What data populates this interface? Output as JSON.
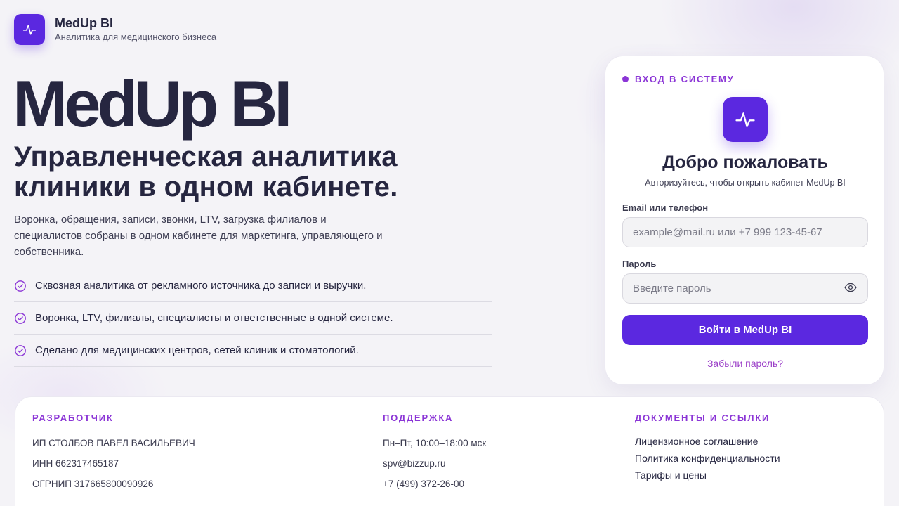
{
  "brand": {
    "name": "MedUp BI",
    "tagline": "Аналитика для медицинского бизнеса"
  },
  "hero": {
    "title": "MedUp BI",
    "subtitle": "Управленческая аналитика клиники в одном кабинете.",
    "description": "Воронка, обращения, записи, звонки, LTV, загрузка филиалов и специалистов собраны в одном кабинете для маркетинга, управляющего и собственника.",
    "features": [
      "Сквозная аналитика от рекламного источника до записи и выручки.",
      "Воронка, LTV, филиалы, специалисты и ответственные в одной системе.",
      "Сделано для медицинских центров, сетей клиник и стоматологий."
    ]
  },
  "login": {
    "eyebrow": "ВХОД В СИСТЕМУ",
    "title": "Добро пожаловать",
    "subtitle": "Авторизуйтесь, чтобы открыть кабинет MedUp BI",
    "email_label": "Email или телефон",
    "email_placeholder": "example@mail.ru или +7 999 123-45-67",
    "password_label": "Пароль",
    "password_placeholder": "Введите пароль",
    "submit_label": "Войти в MedUp BI",
    "forgot_label": "Забыли пароль?"
  },
  "footer": {
    "developer": {
      "heading": "РАЗРАБОТЧИК",
      "lines": [
        "ИП СТОЛБОВ ПАВЕЛ ВАСИЛЬЕВИЧ",
        "ИНН 662317465187",
        "ОГРНИП 317665800090926"
      ]
    },
    "support": {
      "heading": "ПОДДЕРЖКА",
      "lines": [
        "Пн–Пт, 10:00–18:00 мск",
        "spv@bizzup.ru",
        "+7 (499) 372-26-00"
      ]
    },
    "docs": {
      "heading": "ДОКУМЕНТЫ И ССЫЛКИ",
      "links": [
        "Лицензионное соглашение",
        "Политика конфиденциальности",
        "Тарифы и цены"
      ]
    }
  },
  "icons": {
    "logo": "pulse-icon",
    "feature": "check-circle-icon",
    "password_toggle": "eye-icon"
  },
  "colors": {
    "accent": "#5b28e0",
    "accent_text": "#8b35d6",
    "heading": "#262640",
    "background": "#f4f3f7"
  }
}
